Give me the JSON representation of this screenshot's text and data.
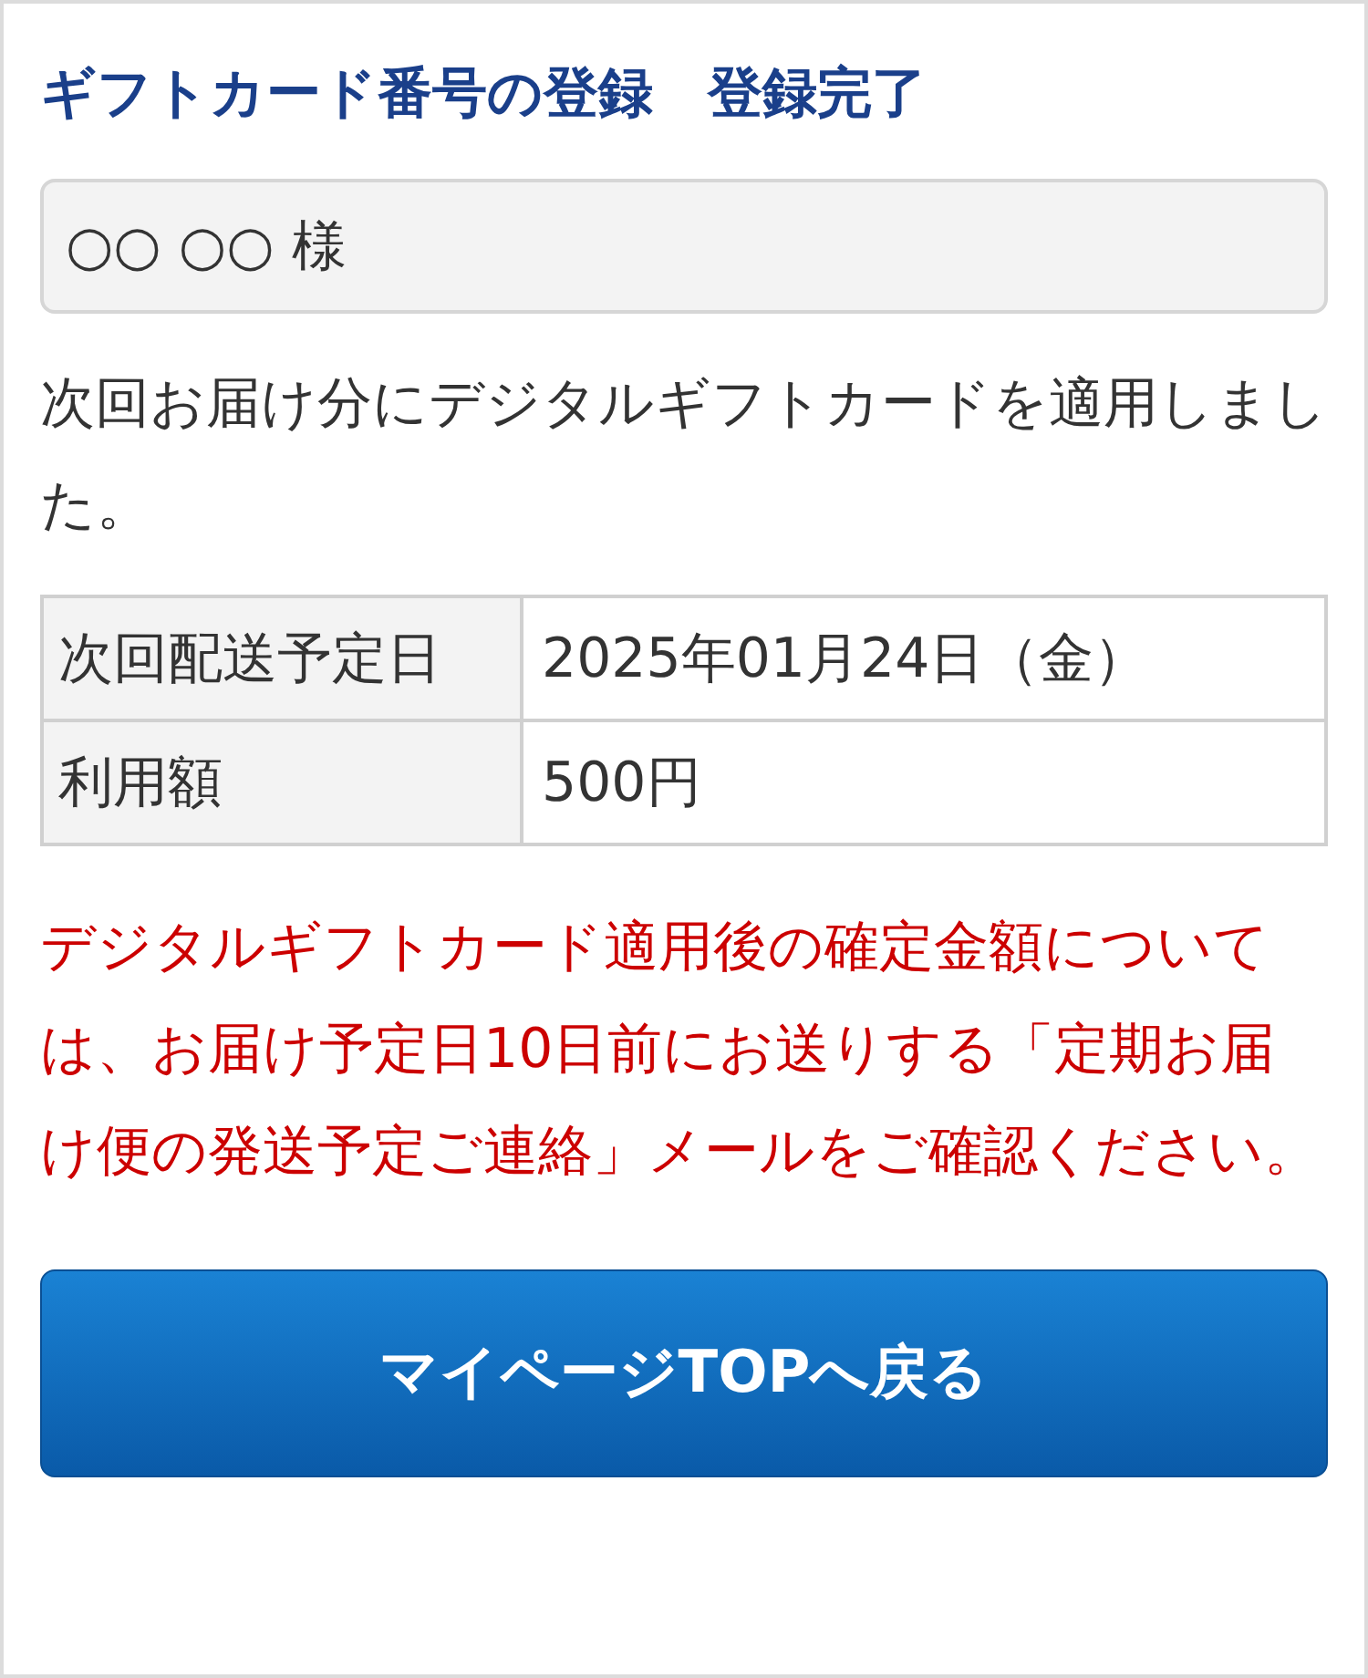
{
  "title": "ギフトカード番号の登録　登録完了",
  "customer_name": "○○ ○○ 様",
  "message": "次回お届け分にデジタルギフトカードを適用しました。",
  "details": [
    {
      "label": "次回配送予定日",
      "value": "2025年01月24日（金）"
    },
    {
      "label": "利用額",
      "value": "500円"
    }
  ],
  "notice": "デジタルギフトカード適用後の確定金額については、お届け予定日10日前にお送りする「定期お届け便の発送予定ご連絡」メールをご確認ください。",
  "button": "マイページTOPへ戻る"
}
